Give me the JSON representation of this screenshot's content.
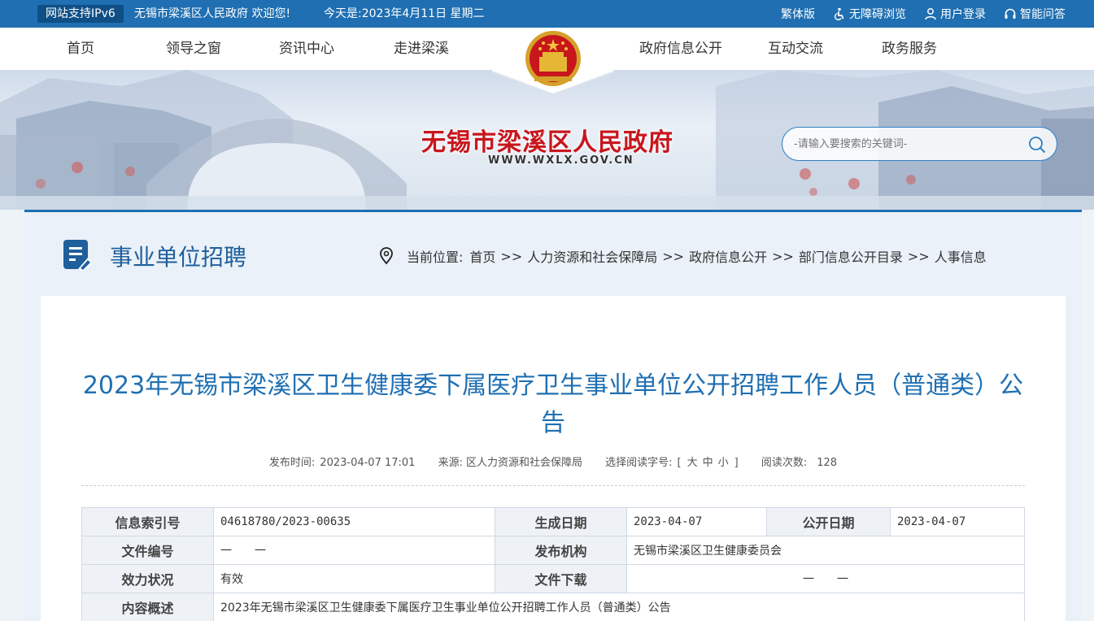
{
  "topbar": {
    "ipv6": "网站支持IPv6",
    "welcome": "无锡市梁溪区人民政府 欢迎您!",
    "today": "今天是:2023年4月11日 星期二",
    "links": [
      {
        "label": "繁体版",
        "icon": "traditional-icon"
      },
      {
        "label": "无障碍浏览",
        "icon": "accessibility-icon"
      },
      {
        "label": "用户登录",
        "icon": "user-icon"
      },
      {
        "label": "智能问答",
        "icon": "headset-icon"
      }
    ]
  },
  "nav": {
    "left": [
      "首页",
      "领导之窗",
      "资讯中心",
      "走进梁溪"
    ],
    "right": [
      "政府信息公开",
      "互动交流",
      "政务服务"
    ]
  },
  "banner": {
    "site_title": "无锡市梁溪区人民政府",
    "site_domain": "WWW.WXLX.GOV.CN",
    "search_placeholder": "-请输入要搜索的关键词-"
  },
  "column": {
    "title": "事业单位招聘",
    "crumb_prefix": "当前位置:",
    "crumbs": [
      "首页",
      "人力资源和社会保障局",
      "政府信息公开",
      "部门信息公开目录",
      "人事信息"
    ],
    "crumb_sep": ">>"
  },
  "article": {
    "title": "2023年无锡市梁溪区卫生健康委下属医疗卫生事业单位公开招聘工作人员（普通类）公告",
    "publish_label": "发布时间:",
    "publish_time": "2023-04-07 17:01",
    "source_label": "来源:",
    "source": "区人力资源和社会保障局",
    "fontsize_label": "选择阅读字号:",
    "fontsize_open": "[",
    "fontsize_options": [
      "大",
      "中",
      "小"
    ],
    "fontsize_close": "]",
    "views_label": "阅读次数:",
    "views": "128"
  },
  "info_table": {
    "index_label": "信息索引号",
    "index_value": "04618780/2023-00635",
    "created_label": "生成日期",
    "created_value": "2023-04-07",
    "public_label": "公开日期",
    "public_value": "2023-04-07",
    "docno_label": "文件编号",
    "docno_value": "一　　一",
    "org_label": "发布机构",
    "org_value": "无锡市梁溪区卫生健康委员会",
    "status_label": "效力状况",
    "status_value": "有效",
    "download_label": "文件下载",
    "download_value": "一　　一",
    "summary_label": "内容概述",
    "summary_value": "2023年无锡市梁溪区卫生健康委下属医疗卫生事业单位公开招聘工作人员（普通类）公告"
  }
}
